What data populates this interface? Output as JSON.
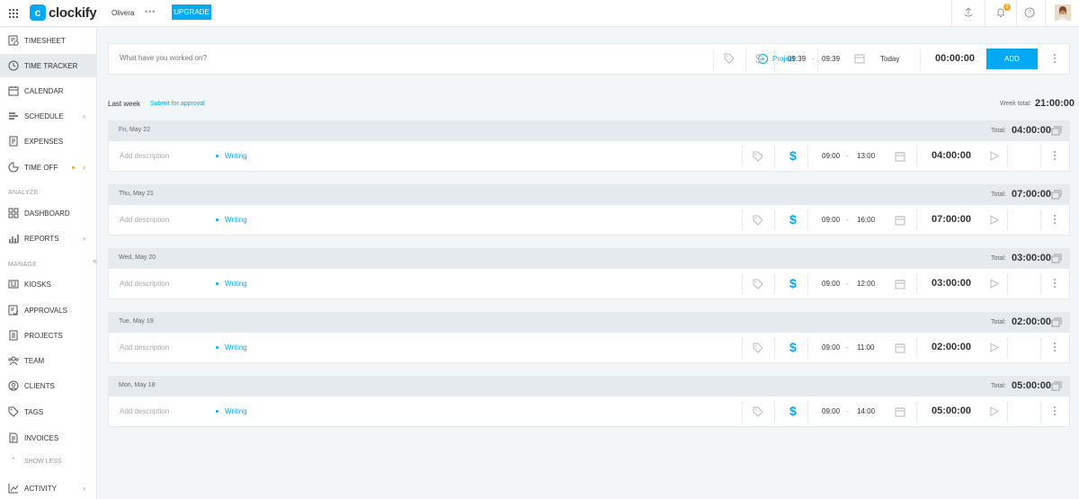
{
  "header": {
    "app_name": "clockify",
    "logo_letter": "c",
    "workspace": "Olivera",
    "workspace_dots": "•••",
    "upgrade_label": "UPGRADE",
    "notifications_count": "2",
    "help_glyph": "?"
  },
  "sidebar": {
    "items_top": [
      {
        "label": "TIMESHEET",
        "icon": "timesheet-icon"
      },
      {
        "label": "TIME TRACKER",
        "icon": "clock-icon",
        "active": true
      },
      {
        "label": "CALENDAR",
        "icon": "calendar-icon"
      },
      {
        "label": "SCHEDULE",
        "icon": "schedule-icon",
        "has_chevron": true
      },
      {
        "label": "EXPENSES",
        "icon": "expenses-icon"
      },
      {
        "label": "TIME OFF",
        "icon": "time-off-icon",
        "has_chevron": true,
        "has_dot": true
      }
    ],
    "analyze_label": "ANALYZE",
    "items_analyze": [
      {
        "label": "DASHBOARD",
        "icon": "dashboard-icon"
      },
      {
        "label": "REPORTS",
        "icon": "reports-icon",
        "has_chevron": true
      }
    ],
    "manage_label": "MANAGE",
    "items_manage": [
      {
        "label": "KIOSKS",
        "icon": "kiosks-icon"
      },
      {
        "label": "APPROVALS",
        "icon": "approvals-icon"
      },
      {
        "label": "PROJECTS",
        "icon": "projects-icon"
      },
      {
        "label": "TEAM",
        "icon": "team-icon"
      },
      {
        "label": "CLIENTS",
        "icon": "clients-icon"
      },
      {
        "label": "TAGS",
        "icon": "tag-icon"
      },
      {
        "label": "INVOICES",
        "icon": "invoices-icon"
      }
    ],
    "show_less_label": "SHOW LESS",
    "items_bottom": [
      {
        "label": "ACTIVITY",
        "icon": "activity-icon",
        "has_chevron": true
      }
    ],
    "collapse_glyph": "«",
    "chevron_glyph": "›"
  },
  "entry_bar": {
    "placeholder": "What have you worked on?",
    "project_label": "Project",
    "dollar": "$",
    "start": "09:39",
    "dash": "-",
    "end": "09:39",
    "date_label": "Today",
    "duration": "00:00:00",
    "add_label": "ADD"
  },
  "week": {
    "label": "Last week",
    "submit_label": "Submit for approval",
    "total_label": "Week total:",
    "total": "21:00:00"
  },
  "days": [
    {
      "date": "Fri, May 22",
      "total_label": "Total:",
      "total": "04:00:00",
      "description": "Add description",
      "project": "Writing",
      "dollar": "$",
      "start": "09:00",
      "dash": "-",
      "end": "13:00",
      "duration": "04:00:00"
    },
    {
      "date": "Thu, May 21",
      "total_label": "Total:",
      "total": "07:00:00",
      "description": "Add description",
      "project": "Writing",
      "dollar": "$",
      "start": "09:00",
      "dash": "-",
      "end": "16:00",
      "duration": "07:00:00"
    },
    {
      "date": "Wed, May 20",
      "total_label": "Total:",
      "total": "03:00:00",
      "description": "Add description",
      "project": "Writing",
      "dollar": "$",
      "start": "09:00",
      "dash": "-",
      "end": "12:00",
      "duration": "03:00:00"
    },
    {
      "date": "Tue, May 19",
      "total_label": "Total:",
      "total": "02:00:00",
      "description": "Add description",
      "project": "Writing",
      "dollar": "$",
      "start": "09:00",
      "dash": "-",
      "end": "11:00",
      "duration": "02:00:00"
    },
    {
      "date": "Mon, May 18",
      "total_label": "Total:",
      "total": "05:00:00",
      "description": "Add description",
      "project": "Writing",
      "dollar": "$",
      "start": "09:00",
      "dash": "-",
      "end": "14:00",
      "duration": "05:00:00"
    }
  ],
  "colors": {
    "accent": "#03a9f4",
    "notification": "#f6a623",
    "background": "#f2f6f8",
    "day_header": "#e4eaee"
  }
}
